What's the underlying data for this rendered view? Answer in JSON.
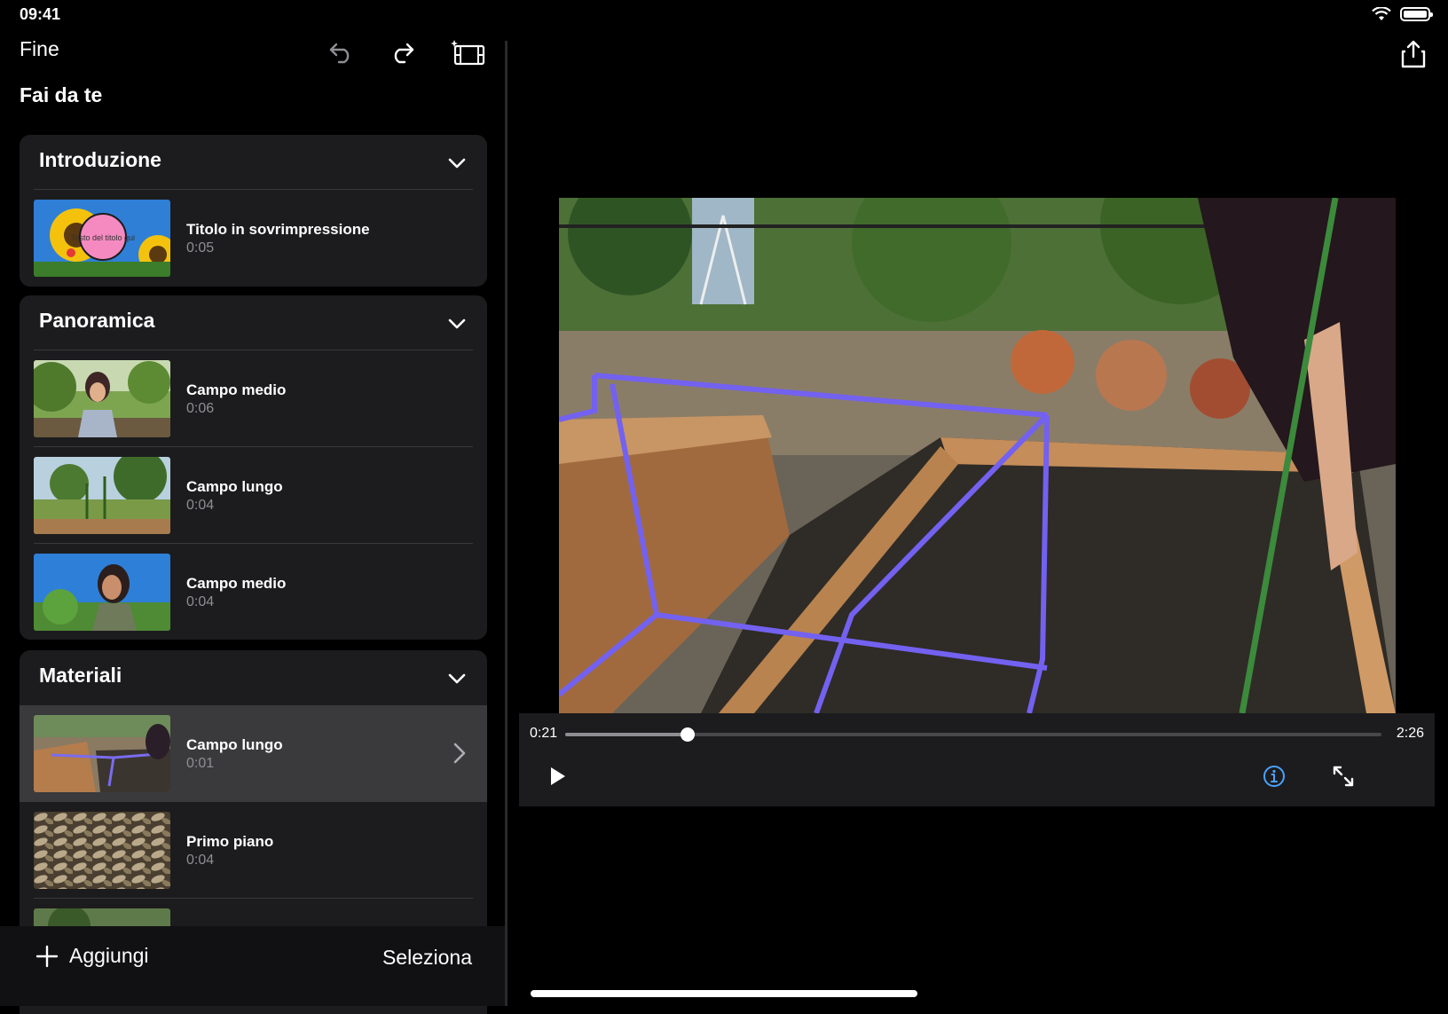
{
  "status_bar": {
    "time": "09:41",
    "battery_level": 1.0
  },
  "toolbar": {
    "done_label": "Fine"
  },
  "project": {
    "title": "Fai da te"
  },
  "sections": [
    {
      "title": "Introduzione",
      "clips": [
        {
          "title": "Titolo in sovrimpressione",
          "duration": "0:05",
          "thumb_text": "Testo del titolo qui"
        }
      ]
    },
    {
      "title": "Panoramica",
      "clips": [
        {
          "title": "Campo medio",
          "duration": "0:06"
        },
        {
          "title": "Campo lungo",
          "duration": "0:04"
        },
        {
          "title": "Campo medio",
          "duration": "0:04"
        }
      ]
    },
    {
      "title": "Materiali",
      "clips": [
        {
          "title": "Campo lungo",
          "duration": "0:01",
          "selected": true
        },
        {
          "title": "Primo piano",
          "duration": "0:04"
        }
      ]
    }
  ],
  "bottom_bar": {
    "add_label": "Aggiungi",
    "select_label": "Seleziona"
  },
  "player": {
    "current_time": "0:21",
    "total_time": "2:26",
    "progress": 0.15
  },
  "colors": {
    "accent": "#0a84ff",
    "panel": "#1c1c1e",
    "selected_row": "#3a3a3c"
  }
}
